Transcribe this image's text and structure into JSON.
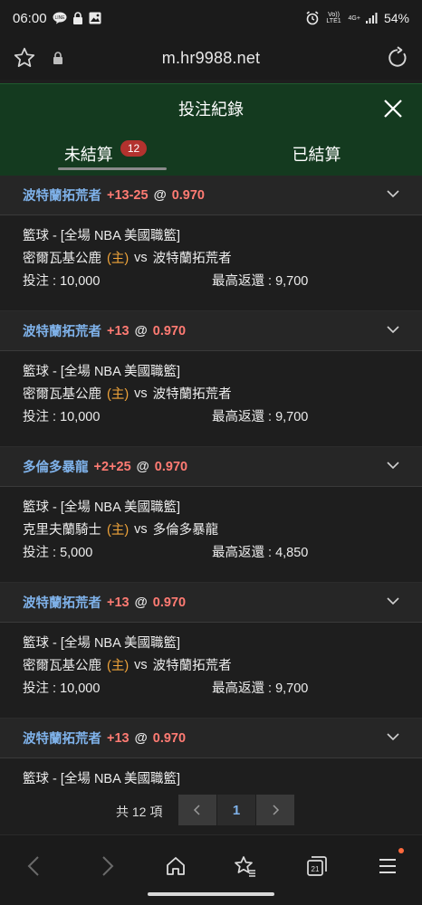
{
  "status_bar": {
    "time": "06:00",
    "network": "Vo)) LTE1",
    "net_type": "4G+",
    "battery": "54%"
  },
  "browser": {
    "url": "m.hr9988.net"
  },
  "dialog": {
    "title": "投注紀錄",
    "tabs": [
      {
        "label": "未結算",
        "badge": "12"
      },
      {
        "label": "已結算"
      }
    ]
  },
  "bets": [
    {
      "selection": "波特蘭拓荒者",
      "handicap": "+13-25",
      "at": "@",
      "odds": "0.970",
      "league": "籃球 - [全場 NBA 美國職籃]",
      "home": "密爾瓦基公鹿",
      "home_tag": "(主)",
      "vs": "vs",
      "away": "波特蘭拓荒者",
      "stake": "投注 : 10,000",
      "max_return": "最高返還 : 9,700"
    },
    {
      "selection": "波特蘭拓荒者",
      "handicap": "+13",
      "at": "@",
      "odds": "0.970",
      "league": "籃球 - [全場 NBA 美國職籃]",
      "home": "密爾瓦基公鹿",
      "home_tag": "(主)",
      "vs": "vs",
      "away": "波特蘭拓荒者",
      "stake": "投注 : 10,000",
      "max_return": "最高返還 : 9,700"
    },
    {
      "selection": "多倫多暴龍",
      "handicap": "+2+25",
      "at": "@",
      "odds": "0.970",
      "league": "籃球 - [全場 NBA 美國職籃]",
      "home": "克里夫蘭騎士",
      "home_tag": "(主)",
      "vs": "vs",
      "away": "多倫多暴龍",
      "stake": "投注 : 5,000",
      "max_return": "最高返還 : 4,850"
    },
    {
      "selection": "波特蘭拓荒者",
      "handicap": "+13",
      "at": "@",
      "odds": "0.970",
      "league": "籃球 - [全場 NBA 美國職籃]",
      "home": "密爾瓦基公鹿",
      "home_tag": "(主)",
      "vs": "vs",
      "away": "波特蘭拓荒者",
      "stake": "投注 : 10,000",
      "max_return": "最高返還 : 9,700"
    },
    {
      "selection": "波特蘭拓荒者",
      "handicap": "+13",
      "at": "@",
      "odds": "0.970",
      "league": "籃球 - [全場 NBA 美國職籃]"
    }
  ],
  "pagination": {
    "total": "共 12 項",
    "current_page": "1"
  },
  "colors": {
    "header_bg": "#143a1f",
    "selection_blue": "#7fb2ea",
    "handicap_red": "#ff7b73",
    "home_orange": "#f0a43a",
    "badge_red": "#b3322e"
  },
  "icons": [
    "star-icon",
    "lock-icon",
    "refresh-icon",
    "close-icon",
    "chevron-down-icon",
    "back-icon",
    "forward-icon",
    "home-icon",
    "bookmark-star-icon",
    "tabs-icon",
    "menu-icon"
  ],
  "bottom_nav": {
    "tabs_count": "21"
  }
}
